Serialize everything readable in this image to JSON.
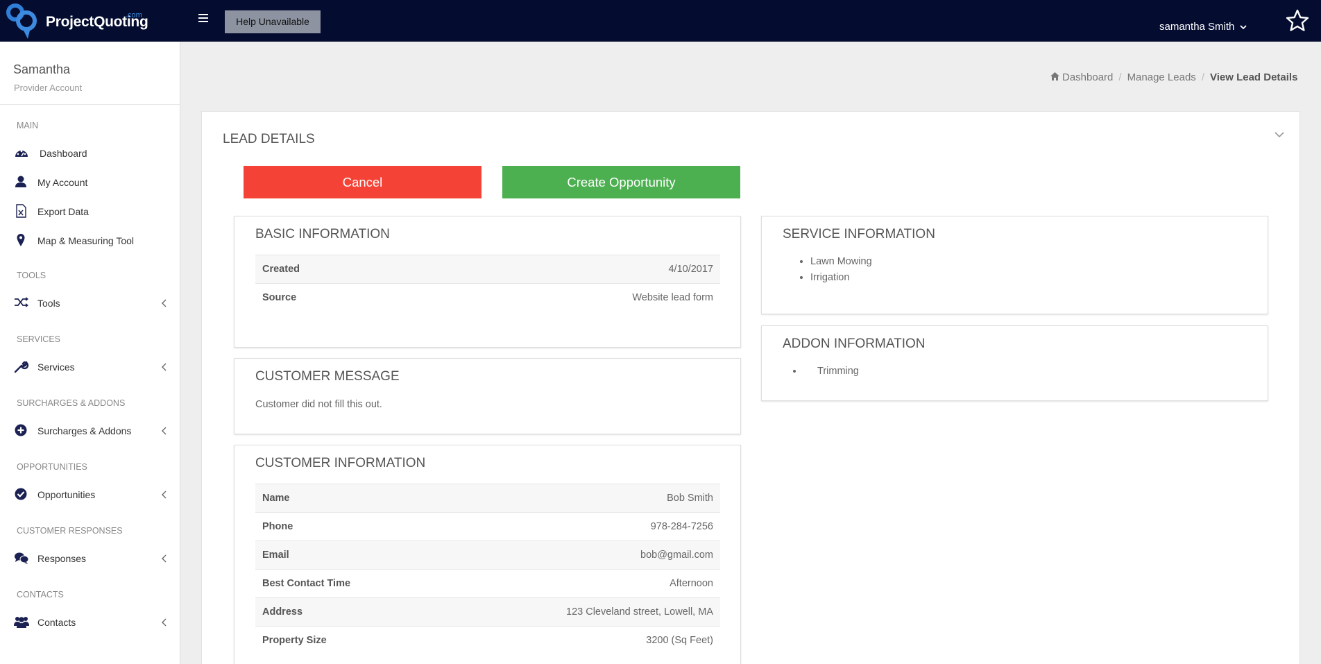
{
  "header": {
    "logo_text": "ProjectQuoting",
    "logo_suffix": ".com",
    "help_label": "Help Unavailable",
    "user_name": "samantha Smith"
  },
  "sidebar": {
    "profile_name": "Samantha",
    "profile_type": "Provider Account",
    "sections": {
      "main": "MAIN",
      "tools": "TOOLS",
      "services": "SERVICES",
      "surcharges": "SURCHARGES & ADDONS",
      "opportunities": "OPPORTUNITIES",
      "responses": "CUSTOMER RESPONSES",
      "contacts": "CONTACTS"
    },
    "items": {
      "dashboard": "Dashboard",
      "my_account": "My Account",
      "export_data": "Export Data",
      "map_tool": "Map & Measuring Tool",
      "tools": "Tools",
      "services": "Services",
      "surcharges": "Surcharges & Addons",
      "opportunities": "Opportunities",
      "responses": "Responses",
      "contacts": "Contacts"
    }
  },
  "breadcrumb": {
    "dashboard": "Dashboard",
    "manage_leads": "Manage Leads",
    "current": "View Lead Details"
  },
  "panel": {
    "title": "LEAD DETAILS",
    "cancel_label": "Cancel",
    "create_label": "Create Opportunity"
  },
  "basic_info": {
    "title": "BASIC INFORMATION",
    "rows": [
      {
        "k": "Created",
        "v": "4/10/2017"
      },
      {
        "k": "Source",
        "v": "Website lead form"
      }
    ]
  },
  "customer_message": {
    "title": "CUSTOMER MESSAGE",
    "text": "Customer did not fill this out."
  },
  "customer_info": {
    "title": "CUSTOMER INFORMATION",
    "rows": [
      {
        "k": "Name",
        "v": "Bob Smith"
      },
      {
        "k": "Phone",
        "v": "978-284-7256"
      },
      {
        "k": "Email",
        "v": "bob@gmail.com"
      },
      {
        "k": "Best Contact Time",
        "v": "Afternoon"
      },
      {
        "k": "Address",
        "v": "123 Cleveland street, Lowell, MA"
      },
      {
        "k": "Property Size",
        "v": "3200 (Sq Feet)"
      }
    ]
  },
  "service_info": {
    "title": "SERVICE INFORMATION",
    "items": [
      "Lawn Mowing",
      "Irrigation"
    ]
  },
  "addon_info": {
    "title": "ADDON INFORMATION",
    "items": [
      "Trimming"
    ]
  },
  "colors": {
    "topbar": "#040c30",
    "cancel": "#f44336",
    "create": "#4caf50",
    "accent": "#3d8be0"
  }
}
